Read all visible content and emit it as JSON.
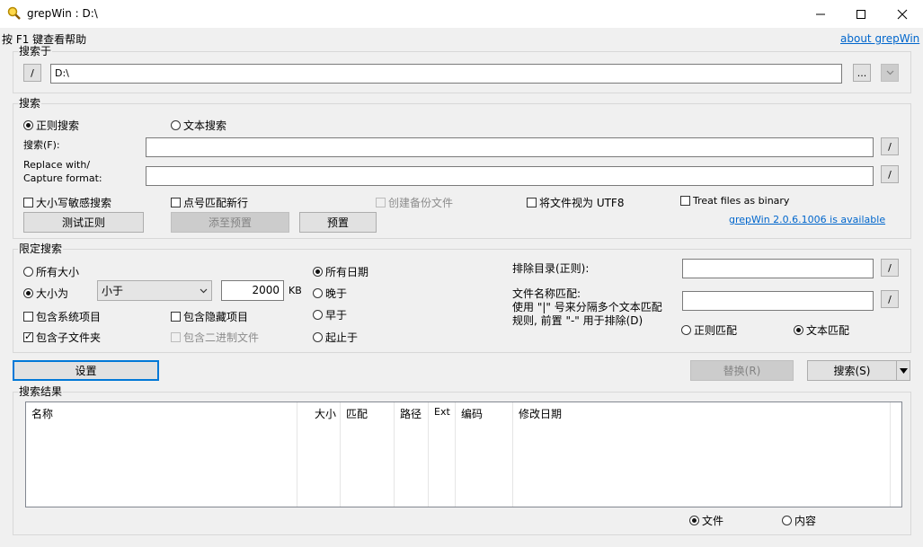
{
  "window": {
    "title": "grepWin : D:\\",
    "icon": "magnifier-icon"
  },
  "help_text": "按 F1 键查看帮助",
  "about_link": "about grepWin",
  "search_in": {
    "group_label": "搜索于",
    "path_value": "D:\\",
    "slash_label": "/",
    "browse_label": "...",
    "dropdown_icon": "chevron-down-icon"
  },
  "search": {
    "group_label": "搜索",
    "regex_label": "正则搜索",
    "text_label": "文本搜索",
    "search_label": "搜索(F):",
    "search_value": "",
    "replace_label1": "Replace with/",
    "replace_label2": "Capture format:",
    "replace_value": "",
    "slash_label": "/",
    "case_label": "大小写敏感搜索",
    "dot_label": "点号匹配新行",
    "backup_label": "创建备份文件",
    "utf8_label": "将文件视为 UTF8",
    "binary_label": "Treat files as binary",
    "test_regex_label": "测试正则",
    "add_preset_label": "添至预置",
    "preset_label": "预置",
    "update_link": "grepWin 2.0.6.1006 is available"
  },
  "limit": {
    "group_label": "限定搜索",
    "all_sizes_label": "所有大小",
    "size_is_label": "大小为",
    "size_op": "小于",
    "size_value": "2000",
    "size_unit": "KB",
    "sys_label": "包含系统项目",
    "hidden_label": "包含隐藏项目",
    "subfolders_label": "包含子文件夹",
    "binary_files_label": "包含二进制文件",
    "all_dates_label": "所有日期",
    "newer_label": "晚于",
    "older_label": "早于",
    "between_label": "起止于",
    "exclude_dirs_label": "排除目录(正则):",
    "exclude_dirs_value": "",
    "file_match_label1": "文件名称匹配:",
    "file_match_label2": "使用 \"|\" 号来分隔多个文本匹配",
    "file_match_label3": "规则, 前置 \"-\" 用于排除(D)",
    "file_match_value": "",
    "regex_match_label": "正则匹配",
    "text_match_label": "文本匹配",
    "slash_label": "/"
  },
  "actions": {
    "settings_label": "设置",
    "replace_label": "替换(R)",
    "search_label": "搜索(S)"
  },
  "results": {
    "group_label": "搜索结果",
    "columns": [
      "名称",
      "大小",
      "匹配",
      "路径",
      "Ext",
      "编码",
      "修改日期"
    ],
    "files_label": "文件",
    "content_label": "内容"
  }
}
